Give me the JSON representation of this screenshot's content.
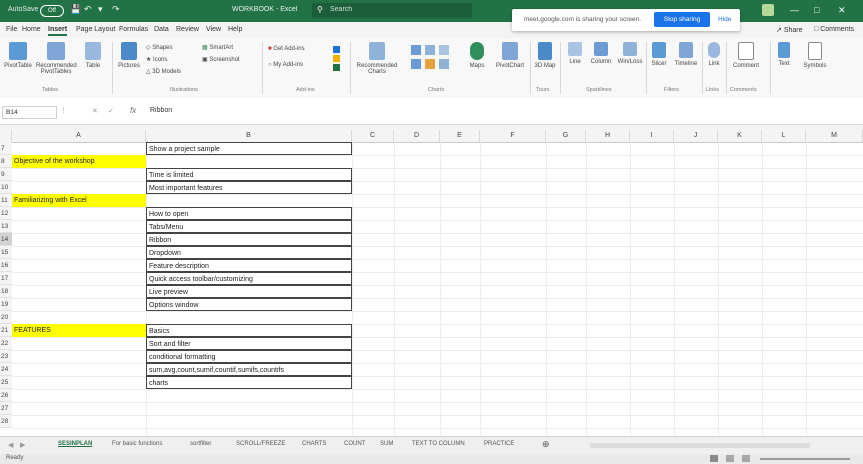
{
  "titlebar": {
    "autosave_label": "AutoSave",
    "toggle_label": "Off",
    "workbook_name": "WORKBOOK - Excel",
    "search_placeholder": "Search",
    "share_message": "meet.google.com is sharing your screen.",
    "stop_sharing_label": "Stop sharing",
    "hide_label": "Hide"
  },
  "menu": {
    "tabs": [
      "File",
      "Home",
      "Insert",
      "Page Layout",
      "Formulas",
      "Data",
      "Review",
      "View",
      "Help"
    ],
    "active_tab": "Insert",
    "share_label": "Share",
    "comments_label": "Comments"
  },
  "ribbon": {
    "items": [
      {
        "label": "PivotTable",
        "icon": "pivottable-icon"
      },
      {
        "label": "Recommended PivotTables",
        "icon": "recommended-pivottables-icon"
      },
      {
        "label": "Table",
        "icon": "table-icon"
      },
      {
        "label": "Pictures",
        "icon": "pictures-icon"
      },
      {
        "label": "Shapes",
        "icon": "shapes-icon"
      },
      {
        "label": "Icons",
        "icon": "icons-icon"
      },
      {
        "label": "3D Models",
        "icon": "3d-models-icon"
      },
      {
        "label": "SmartArt",
        "icon": "smartart-icon"
      },
      {
        "label": "Screenshot",
        "icon": "screenshot-icon"
      },
      {
        "label": "Get Add-ins",
        "icon": "get-addins-icon"
      },
      {
        "label": "My Add-ins",
        "icon": "my-addins-icon"
      },
      {
        "label": "Recommended Charts",
        "icon": "recommended-charts-icon"
      },
      {
        "label": "Maps",
        "icon": "maps-icon"
      },
      {
        "label": "PivotChart",
        "icon": "pivotchart-icon"
      },
      {
        "label": "3D Map",
        "icon": "3d-map-icon"
      },
      {
        "label": "Line",
        "icon": "sparkline-line-icon"
      },
      {
        "label": "Column",
        "icon": "sparkline-column-icon"
      },
      {
        "label": "Win/Loss",
        "icon": "sparkline-winloss-icon"
      },
      {
        "label": "Slicer",
        "icon": "slicer-icon"
      },
      {
        "label": "Timeline",
        "icon": "timeline-icon"
      },
      {
        "label": "Link",
        "icon": "link-icon"
      },
      {
        "label": "Comment",
        "icon": "comment-icon"
      },
      {
        "label": "Text",
        "icon": "text-icon"
      },
      {
        "label": "Symbols",
        "icon": "symbols-icon"
      }
    ],
    "groups": [
      "Tables",
      "Illustrations",
      "Add-ins",
      "Charts",
      "Tours",
      "Sparklines",
      "Filters",
      "Links",
      "Comments"
    ]
  },
  "formula_bar": {
    "name_box": "B14",
    "fx_label": "fx",
    "content": "Ribbon"
  },
  "grid": {
    "columns": [
      "A",
      "B",
      "C",
      "D",
      "E",
      "F",
      "G",
      "H",
      "I",
      "J",
      "K",
      "L",
      "M"
    ],
    "rows": [
      {
        "num": "7",
        "a": "",
        "b": "Show a project sample"
      },
      {
        "num": "8",
        "a": "Objective of the workshop",
        "b": ""
      },
      {
        "num": "9",
        "a": "",
        "b": "Time is limited"
      },
      {
        "num": "10",
        "a": "",
        "b": "Most important features"
      },
      {
        "num": "11",
        "a": "Familiarizing with Excel",
        "b": ""
      },
      {
        "num": "12",
        "a": "",
        "b": "How to open"
      },
      {
        "num": "13",
        "a": "",
        "b": "Tabs/Menu"
      },
      {
        "num": "14",
        "a": "",
        "b": "Ribbon"
      },
      {
        "num": "15",
        "a": "",
        "b": "Dropdown"
      },
      {
        "num": "16",
        "a": "",
        "b": "Feature description"
      },
      {
        "num": "17",
        "a": "",
        "b": "Quick access toolbar/customizing"
      },
      {
        "num": "18",
        "a": "",
        "b": "Live preview"
      },
      {
        "num": "19",
        "a": "",
        "b": "Options window"
      },
      {
        "num": "20",
        "a": "",
        "b": ""
      },
      {
        "num": "21",
        "a": "FEATURES",
        "b": "Basics"
      },
      {
        "num": "22",
        "a": "",
        "b": "Sort and filter"
      },
      {
        "num": "23",
        "a": "",
        "b": "conditional formatting"
      },
      {
        "num": "24",
        "a": "",
        "b": "sum,avg,count,sumif,countif,sumifs,countifs"
      },
      {
        "num": "25",
        "a": "",
        "b": "charts"
      },
      {
        "num": "26",
        "a": "",
        "b": ""
      },
      {
        "num": "27",
        "a": "",
        "b": ""
      },
      {
        "num": "28",
        "a": "",
        "b": ""
      }
    ],
    "selected_row": "14",
    "highlight_color": "#ffff00"
  },
  "sheets": {
    "tabs": [
      "SESINPLAN",
      "For basic functions",
      "sortfilter",
      "SCROLL/FREEZE",
      "CHARTS",
      "COUNT",
      "SUM",
      "TEXT TO COLUMN",
      "PRACTICE"
    ],
    "active": "SESINPLAN"
  },
  "status": {
    "ready_label": "Ready"
  },
  "colors": {
    "excel_green": "#217346",
    "share_blue": "#1a73e8"
  }
}
